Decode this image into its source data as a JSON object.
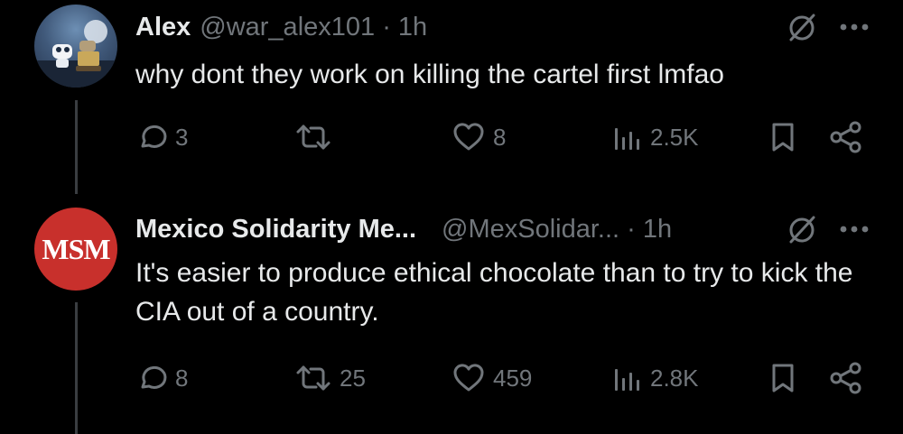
{
  "tweets": [
    {
      "name": "Alex",
      "handle": "@war_alex101 · 1h",
      "text": "why dont they work on killing the cartel first lmfao",
      "replies": "3",
      "reposts": "",
      "likes": "8",
      "views": "2.5K"
    },
    {
      "name": "Mexico Solidarity Me...",
      "handle": "@MexSolidar... · 1h",
      "avatar_text": "MSM",
      "text": "It's easier to produce ethical chocolate than to try to kick the CIA out of a country.",
      "replies": "8",
      "reposts": "25",
      "likes": "459",
      "views": "2.8K"
    }
  ],
  "colors": {
    "background": "#000000",
    "text": "#e7e9ea",
    "secondary": "#71767b",
    "avatar_msm": "#c8302c"
  },
  "icons": [
    "reply-icon",
    "repost-icon",
    "like-icon",
    "views-icon",
    "bookmark-icon",
    "share-icon",
    "grok-icon",
    "more-icon"
  ]
}
